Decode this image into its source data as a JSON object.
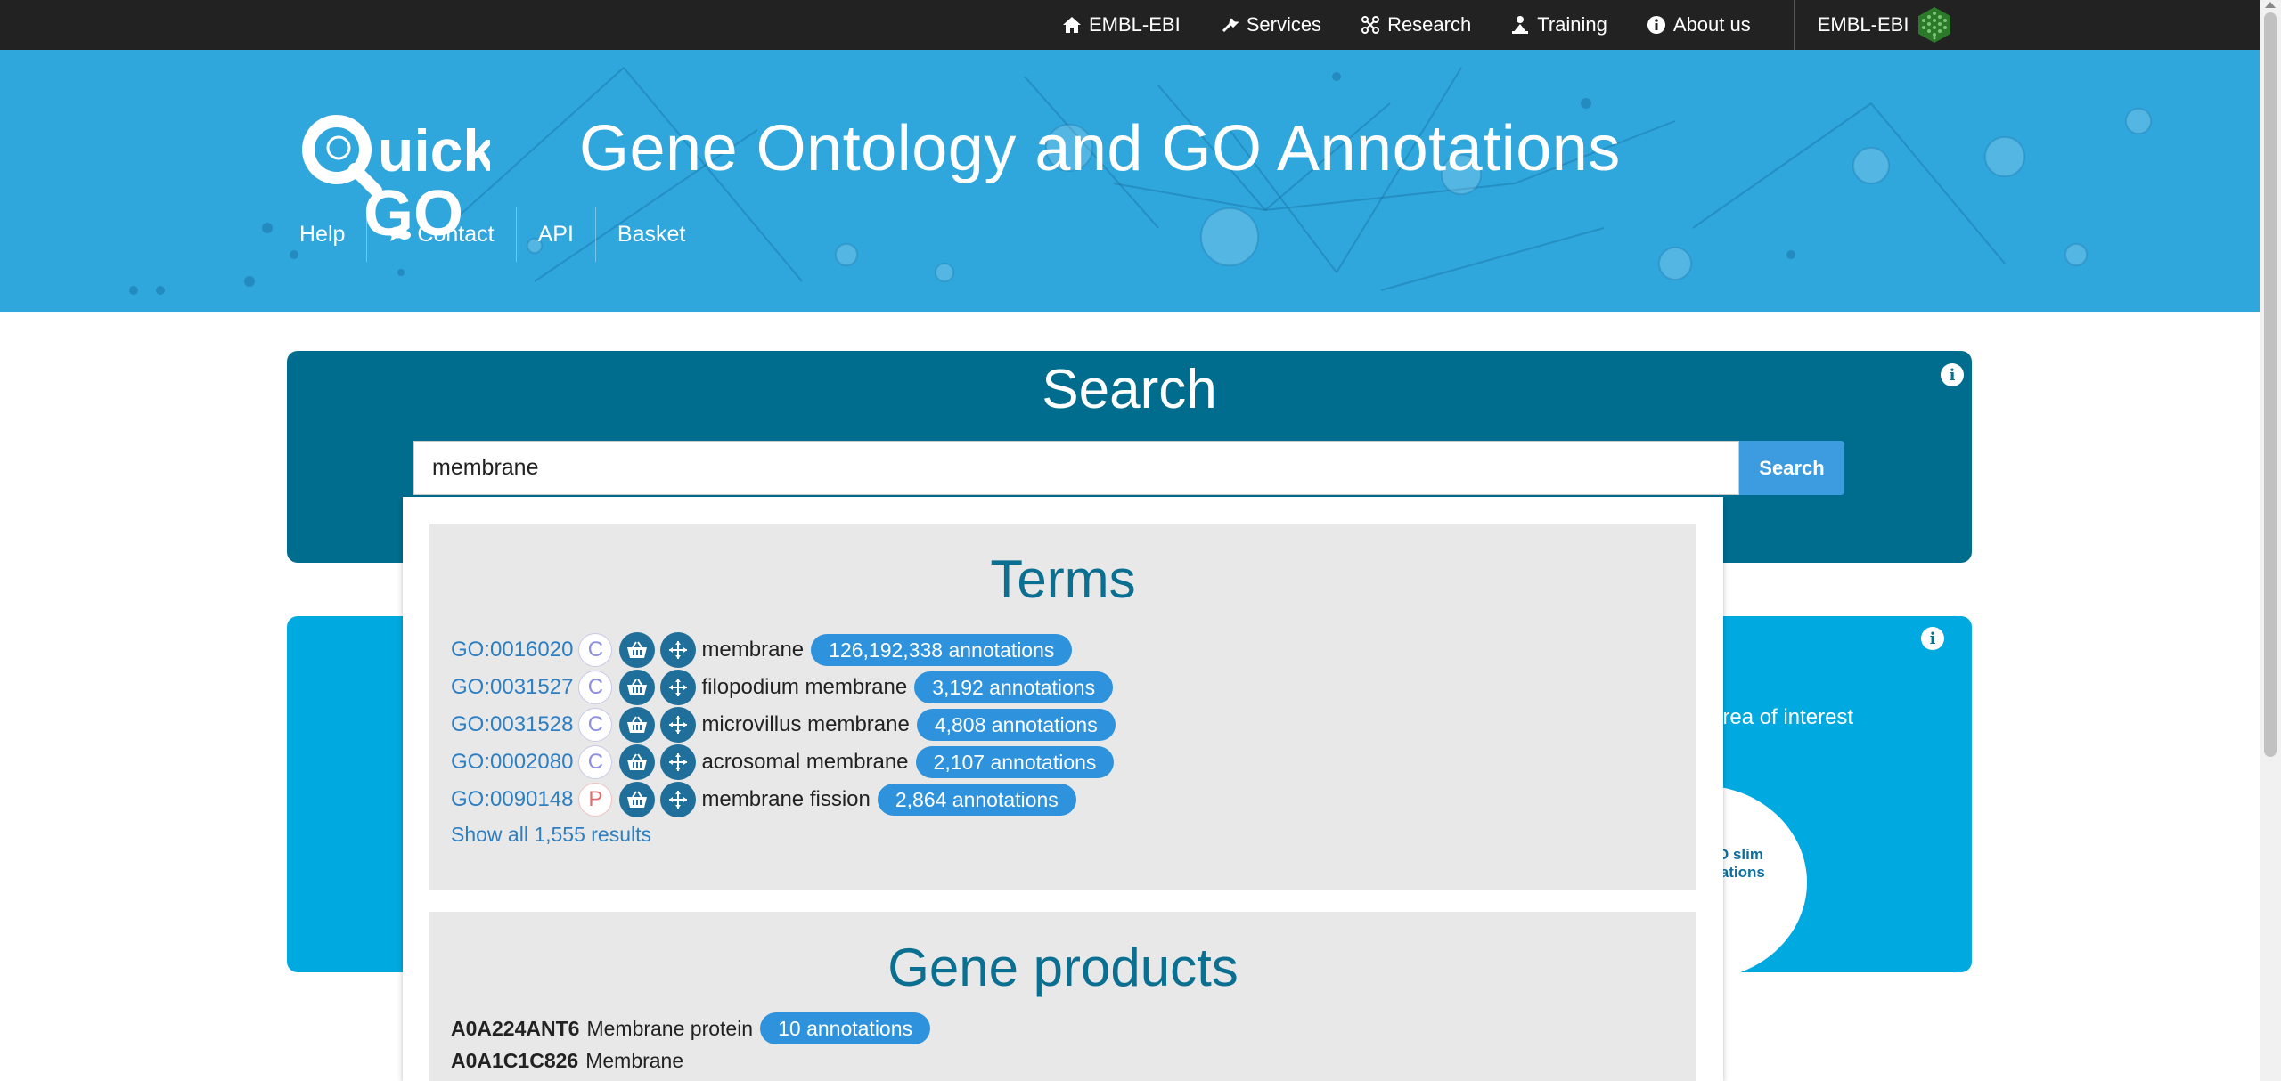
{
  "global_nav": {
    "items": [
      {
        "label": "EMBL-EBI",
        "icon": "home-icon"
      },
      {
        "label": "Services",
        "icon": "wrench-icon"
      },
      {
        "label": "Research",
        "icon": "molecule-icon"
      },
      {
        "label": "Training",
        "icon": "trainer-icon"
      },
      {
        "label": "About us",
        "icon": "info-icon"
      }
    ],
    "brand": "EMBL-EBI"
  },
  "masthead": {
    "logo": "QuickGO",
    "title": "Gene Ontology and GO Annotations",
    "local_nav": [
      {
        "label": "Help"
      },
      {
        "label": "Contact",
        "icon": "chat-icon"
      },
      {
        "label": "API"
      },
      {
        "label": "Basket"
      }
    ]
  },
  "search": {
    "heading": "Search",
    "query": "membrane",
    "button_label": "Search"
  },
  "slim_panel": {
    "text_fragment": "area of interest",
    "circle_text_line1": "O slim",
    "circle_text_line2": "tations"
  },
  "dropdown": {
    "terms": {
      "title": "Terms",
      "rows": [
        {
          "id": "GO:0016020",
          "aspect": "C",
          "name": "membrane",
          "annotations": "126,192,338 annotations"
        },
        {
          "id": "GO:0031527",
          "aspect": "C",
          "name": "filopodium membrane",
          "annotations": "3,192 annotations"
        },
        {
          "id": "GO:0031528",
          "aspect": "C",
          "name": "microvillus membrane",
          "annotations": "4,808 annotations"
        },
        {
          "id": "GO:0002080",
          "aspect": "C",
          "name": "acrosomal membrane",
          "annotations": "2,107 annotations"
        },
        {
          "id": "GO:0090148",
          "aspect": "P",
          "name": "membrane fission",
          "annotations": "2,864 annotations"
        }
      ],
      "show_all": "Show all 1,555 results"
    },
    "gene_products": {
      "title": "Gene products",
      "rows": [
        {
          "id": "A0A224ANT6",
          "name": "Membrane protein",
          "annotations": "10 annotations"
        },
        {
          "id": "A0A1C1C826",
          "name": "Membrane",
          "annotations": ""
        }
      ]
    }
  },
  "colors": {
    "global_bar": "#222222",
    "masthead": "#2fa6dc",
    "search_panel": "#006d8f",
    "slim_panel": "#00a9e0",
    "accent_pill": "#2e92dc",
    "link": "#2e7ec2",
    "aspect_c": "#8f8fe0",
    "aspect_p": "#e07070"
  }
}
